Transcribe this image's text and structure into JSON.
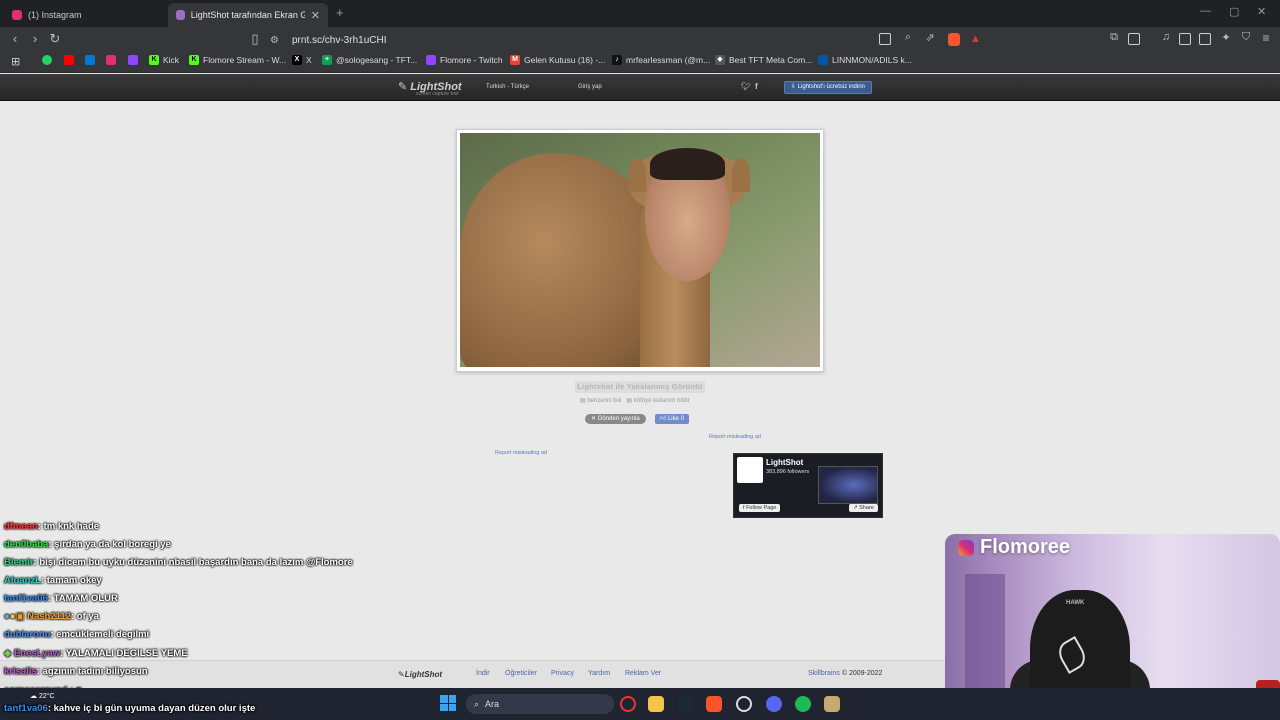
{
  "browser": {
    "tabs": [
      {
        "title": "(1) Instagram",
        "color": "#e1306c"
      },
      {
        "title": "LightShot tarafından Ekran Görü",
        "color": "#9b6fc4"
      }
    ],
    "url": "prnt.sc/chv-3rh1uCHI",
    "bookmarks": [
      {
        "label": "",
        "color": "#25d366"
      },
      {
        "label": "",
        "color": "#ff0000"
      },
      {
        "label": "",
        "color": "#0078d4"
      },
      {
        "label": "",
        "color": "#e1306c"
      },
      {
        "label": "",
        "color": "#9146ff"
      },
      {
        "label": "Kick",
        "color": "#53fc18"
      },
      {
        "label": "Flomore Stream - W...",
        "color": "#53fc18"
      },
      {
        "label": "X",
        "color": "#000000"
      },
      {
        "label": "@sologesang - TFT...",
        "color": "#0f9d58"
      },
      {
        "label": "Flomore - Twitch",
        "color": "#9146ff"
      },
      {
        "label": "Gelen Kutusu (16) -...",
        "color": "#ea4335"
      },
      {
        "label": "mrfearlessman (@m...",
        "color": "#111111"
      },
      {
        "label": "Best TFT Meta Com...",
        "color": "#555555"
      },
      {
        "label": "LINNMON/ADILS k...",
        "color": "#0058a3"
      }
    ]
  },
  "lightshot": {
    "logo": "LightShot",
    "tagline": "screen capture tool",
    "language": "Turkish - Türkçe",
    "login": "Giriş yap",
    "download": "Lightshot'ı ücretsiz indirin",
    "caption": "Lightshot ile Yakalanmış Görüntü",
    "similar": "benzerini bul",
    "report_abuse": "kötüye kullanım bildir",
    "tweet": "Gönderi yayınla",
    "like": "Like 0",
    "report_ad": "Report misleading ad",
    "fb": {
      "name": "LightShot",
      "followers": "383,896 followers",
      "follow": "Follow Page",
      "share": "Share"
    },
    "footer": {
      "logo": "LightShot",
      "links": [
        "İndir",
        "Öğreticiler",
        "Privacy",
        "Yardım",
        "Reklam Ver"
      ],
      "brand": "Skillbrains",
      "copy": "© 2009-2022"
    }
  },
  "chat": [
    {
      "user": "dfmean",
      "color": "#ff3b3b",
      "msg": ": tm knk hade"
    },
    {
      "user": "den0baba",
      "color": "#39e04a",
      "msg": ": şırdan ya da kol boregi ye"
    },
    {
      "user": "Blemir",
      "color": "#39d28a",
      "msg": ": bişi dicem bu uyku düzenini nbasil başardın bana da lazım @Flomore"
    },
    {
      "user": "AluanzL",
      "color": "#2ed0c7",
      "msg": ": tamam okey"
    },
    {
      "user": "tanf1va06",
      "color": "#3a8ee8",
      "msg": ": TAMAM OLUR"
    },
    {
      "user": "Nash2112",
      "color": "#f2a23a",
      "msg": ": of ya"
    },
    {
      "user": "dublaronu",
      "color": "#4f8de0",
      "msg": ": emcüklemeli degilmi"
    },
    {
      "user": "EnesLyaw",
      "color": "#b05de0",
      "msg": ": YALAMALI DEGILSE YEME"
    },
    {
      "user": "krisalis",
      "color": "#c94fe0",
      "msg": ": agzının tadını biliyosun"
    },
    {
      "user": "corpsearound",
      "color": "#c35ee8",
      "msg": " :"
    },
    {
      "user": "tanf1va06",
      "color": "#3a8ee8",
      "msg": ": kahve iç bi gün uyuma dayan düzen olur işte"
    }
  ],
  "stream": {
    "title": "Flomoree",
    "chair_brand": "HAWK"
  },
  "taskbar": {
    "search": "Ara",
    "weather": "22°C"
  }
}
